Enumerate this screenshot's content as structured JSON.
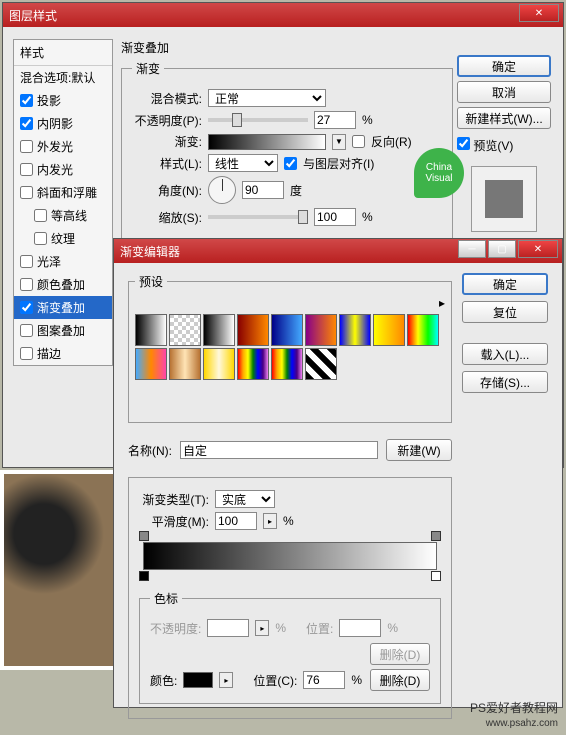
{
  "layerStyle": {
    "title": "图层样式",
    "stylesHeader": "样式",
    "blendOptionsDefault": "混合选项:默认",
    "items": [
      {
        "label": "投影",
        "checked": true
      },
      {
        "label": "内阴影",
        "checked": true
      },
      {
        "label": "外发光",
        "checked": false
      },
      {
        "label": "内发光",
        "checked": false
      },
      {
        "label": "斜面和浮雕",
        "checked": false
      },
      {
        "label": "等高线",
        "checked": false,
        "indent": true
      },
      {
        "label": "纹理",
        "checked": false,
        "indent": true
      },
      {
        "label": "光泽",
        "checked": false
      },
      {
        "label": "颜色叠加",
        "checked": false
      },
      {
        "label": "渐变叠加",
        "checked": true,
        "selected": true
      },
      {
        "label": "图案叠加",
        "checked": false
      },
      {
        "label": "描边",
        "checked": false
      }
    ],
    "gradientOverlay": {
      "sectionTitle": "渐变叠加",
      "gradientGroup": "渐变",
      "blendModeLabel": "混合模式:",
      "blendMode": "正常",
      "opacityLabel": "不透明度(P):",
      "opacity": "27",
      "opacityUnit": "%",
      "gradientLabel": "渐变:",
      "reverseLabel": "反向(R)",
      "styleLabel": "样式(L):",
      "style": "线性",
      "alignLabel": "与图层对齐(I)",
      "angleLabel": "角度(N):",
      "angle": "90",
      "angleUnit": "度",
      "scaleLabel": "缩放(S):",
      "scale": "100",
      "scaleUnit": "%"
    },
    "buttons": {
      "ok": "确定",
      "cancel": "取消",
      "newStyle": "新建样式(W)...",
      "preview": "预览(V)"
    }
  },
  "gradientEditor": {
    "title": "渐变编辑器",
    "presetsLabel": "预设",
    "presets": [
      "linear-gradient(90deg,#000,#fff)",
      "repeating-conic-gradient(#ccc 0 25%,#fff 0 50%) 0/8px 8px",
      "linear-gradient(90deg,#000,#fff)",
      "linear-gradient(90deg,#800,#f80)",
      "linear-gradient(90deg,#008,#4af)",
      "linear-gradient(90deg,#808,#f80)",
      "linear-gradient(90deg,#00f,#ff0,#00f)",
      "linear-gradient(90deg,#ff0,#f80)",
      "linear-gradient(90deg,#f00,#ff0,#0f0,#0ff)",
      "linear-gradient(90deg,#4af,#f80,#f4a)",
      "linear-gradient(90deg,#b87333,#ffe4b5,#b87333)",
      "linear-gradient(90deg,#ffd700,#fff8dc,#ffd700)",
      "linear-gradient(90deg,red,orange,yellow,green,blue,indigo,violet)",
      "linear-gradient(90deg,red,orange,yellow,green,blue,indigo,violet)",
      "repeating-linear-gradient(45deg,#000 0 6px,#fff 6px 12px)"
    ],
    "nameLabel": "名称(N):",
    "name": "自定",
    "newBtn": "新建(W)",
    "gradTypeLabel": "渐变类型(T):",
    "gradType": "实底",
    "smoothLabel": "平滑度(M):",
    "smooth": "100",
    "smoothUnit": "%",
    "stopsLabel": "色标",
    "stopOpacityLabel": "不透明度:",
    "stopOpacityUnit": "%",
    "stopPosLabel": "位置:",
    "stopPosUnit": "%",
    "deleteBtn": "删除(D)",
    "colorLabel": "颜色:",
    "colorPosLabel": "位置(C):",
    "colorPos": "76",
    "colorPosUnit": "%",
    "buttons": {
      "ok": "确定",
      "reset": "复位",
      "load": "载入(L)...",
      "save": "存储(S)..."
    }
  },
  "badge": "China Visual",
  "footer": {
    "line1": "PS爱好者教程网",
    "line2": "www.psahz.com"
  }
}
